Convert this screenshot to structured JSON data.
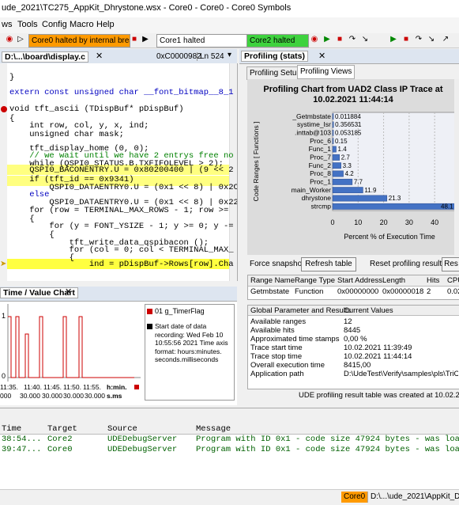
{
  "window": {
    "title": "ude_2021\\TC275_AppKit_Dhrystone.wsx - Core0 - Core0 - Core0 Symbols"
  },
  "menu": [
    "ws",
    "Tools",
    "Config",
    "Macro",
    "Help"
  ],
  "toolbar": {
    "core_status_label": "Core0 halted by internal break",
    "core1_label": "Core1 halted",
    "core2_label": "Core2 halted"
  },
  "editor": {
    "file_tab": "D:\\...\\board\\display.c",
    "address": "0xC0000982",
    "line_label": "Ln 524",
    "lines": [
      "}",
      "",
      "extern const unsigned char __font_bitmap__8_1",
      "void tft_ascii (TDispBuf* pDispBuf)",
      "{",
      "    int row, col, y, x, ind;",
      "    unsigned char mask;",
      "",
      "    tft_display_home (0, 0);",
      "    // we wait until we have 2 entrys free no",
      "    while (QSPI0_STATUS.B.TXFIFOLEVEL > 2);",
      "    QSPI0_BACONENTRY.U = 0x80200400 | (9 << 2",
      "    if (tft_id == 0x9341)",
      "        QSPI0_DATAENTRY0.U = (0x1 << 8) | 0x2C;",
      "    else",
      "        QSPI0_DATAENTRY0.U = (0x1 << 8) | 0x22;",
      "    for (row = TERMINAL_MAX_ROWS - 1; row >=",
      "    {",
      "        for (y = FONT_YSIZE - 1; y >= 0; y -=",
      "        {",
      "            tft_write_data_qspibacon ();",
      "            for (col = 0; col < TERMINAL_MAX_",
      "            {",
      "                ind = pDispBuf->Rows[row].Cha"
    ]
  },
  "profiling": {
    "panel_tab": "Profiling (stats)",
    "subtabs": [
      "Profiling Setup",
      "Profiling Views"
    ],
    "force_snapshot": "Force snapshot",
    "refresh_table": "Refresh table",
    "reset_label": "Reset profiling results:",
    "reset_button": "Res",
    "table_headers": [
      "Range Name",
      "Range Type",
      "Start Address",
      "Length",
      "Hits",
      "CPU"
    ],
    "table_rows": [
      [
        "Getmbstate",
        "Function",
        "0x00000000",
        "0x00000018",
        "2",
        "0.02"
      ]
    ],
    "params_headers": [
      "Global Parameter and Results",
      "Current Values"
    ],
    "params": [
      [
        "Available ranges",
        "12"
      ],
      [
        "Available hits",
        "8445"
      ],
      [
        "Approximated time stamps",
        "0,00 %"
      ],
      [
        "Trace start time",
        "10.02.2021 11:39:49"
      ],
      [
        "Trace stop time",
        "10.02.2021 11:44:14"
      ],
      [
        "Overall execution time",
        "8415,00"
      ],
      [
        "Application path",
        "D:\\UdeTest\\Verify\\samples\\pls\\TriCore2\\"
      ]
    ],
    "footer": "UDE profiling result table was created at 10.02.2021 1"
  },
  "chart_data": {
    "type": "bar",
    "title": "Profiling Chart from UAD2 Class IP Trace at 10.02.2021 11:44:14",
    "xlabel": "Percent % of Execution Time",
    "ylabel": "Code Ranges [ Functions ]",
    "categories": [
      "_Getmbstate",
      "systime_Isr",
      ".inttab@103",
      "Proc_6",
      "Func_1",
      "Proc_7",
      "Func_2",
      "Proc_8",
      "Proc_1",
      "main_Worker",
      "dhrystone",
      "strcmp"
    ],
    "values": [
      0.011884,
      0.356531,
      0.053185,
      0.15,
      1.4,
      2.7,
      3.3,
      4.2,
      7.7,
      11.9,
      21.3,
      48.1
    ],
    "value_labels": [
      "0.011884",
      "0.356531",
      "0.053185",
      "0.15",
      "1.4",
      "2.7",
      "3.3",
      "4.2",
      "7.7",
      "11.9",
      "21.3",
      "48.1"
    ],
    "xticks": [
      "0",
      "10",
      "20",
      "30",
      "40"
    ],
    "xlim": [
      0,
      48
    ]
  },
  "time_value": {
    "tab": "Time / Value Chart",
    "legend": "01 g_TimerFlag",
    "note": "Start date of data recording: Wed Feb 10 10:55:56 2021 Time axis format: hours:minutes. seconds.milliseconds",
    "xticks": [
      "11:35.",
      "11:40.",
      "11:45.",
      "11:50.",
      "11:55.",
      "h:min."
    ],
    "xticks2": [
      "000",
      "30.000",
      "30.000",
      "30.000",
      "30.000",
      "s.ms"
    ],
    "y_top": "1",
    "y_bottom": "0"
  },
  "log": {
    "headers": [
      "Time",
      "Target",
      "Source",
      "Message"
    ],
    "rows": [
      [
        "38:54...",
        "Core2",
        "UDEDebugServer",
        "Program with ID 0x1 - code size 47924 bytes - was loade"
      ],
      [
        "39:47...",
        "Core0",
        "UDEDebugServer",
        "Program with ID 0x1 - code size 47924 bytes - was loade"
      ]
    ]
  },
  "status": {
    "core": "Core0",
    "path": "D:\\...\\ude_2021\\AppKit_Dhryst"
  },
  "colors": {
    "accent_orange": "#ff9a00",
    "green": "#3ed23e",
    "bar_blue": "#4472c4",
    "highlight_yellow": "#ffff40"
  }
}
